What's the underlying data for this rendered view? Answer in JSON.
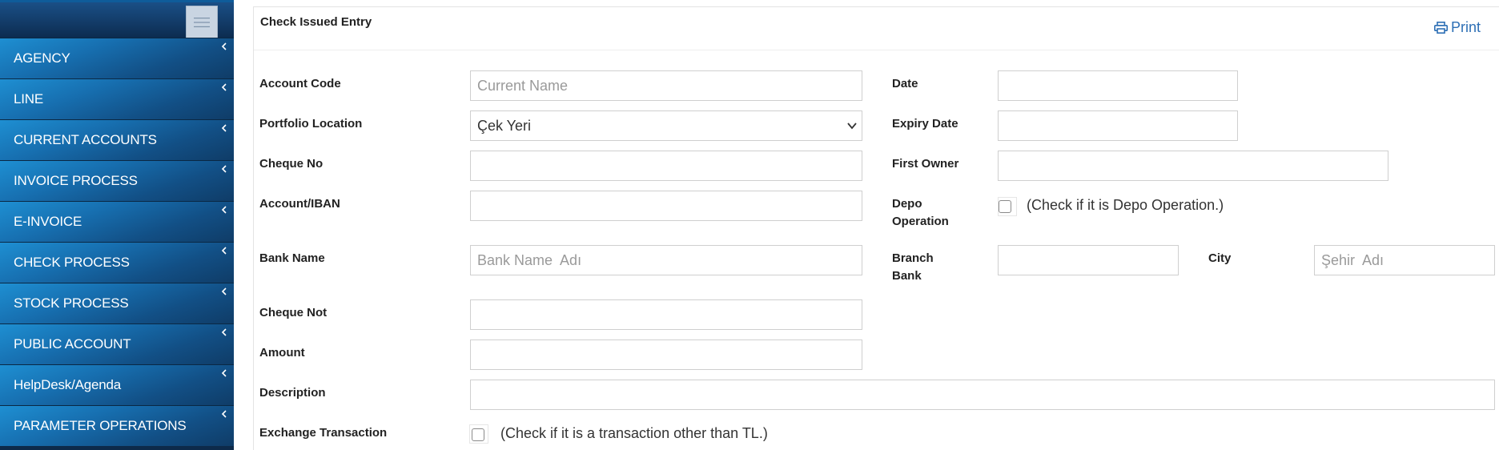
{
  "sidebar": {
    "items": [
      {
        "label": "AGENCY"
      },
      {
        "label": "LINE"
      },
      {
        "label": "CURRENT ACCOUNTS"
      },
      {
        "label": "INVOICE PROCESS"
      },
      {
        "label": "E-INVOICE"
      },
      {
        "label": "CHECK PROCESS"
      },
      {
        "label": "STOCK PROCESS"
      },
      {
        "label": "PUBLIC ACCOUNT"
      },
      {
        "label": "HelpDesk/Agenda"
      },
      {
        "label": "PARAMETER OPERATIONS"
      }
    ]
  },
  "header": {
    "title": "Check Issued Entry",
    "print_label": "Print"
  },
  "form": {
    "account_code_label": "Account Code",
    "account_code_placeholder": "Current Name",
    "date_label": "Date",
    "portfolio_location_label": "Portfolio Location",
    "portfolio_location_value": "Çek Yeri",
    "expiry_date_label": "Expiry Date",
    "cheque_no_label": "Cheque No",
    "first_owner_label": "First Owner",
    "account_iban_label": "Account/IBAN",
    "depo_operation_label_1": "Depo",
    "depo_operation_label_2": "Operation",
    "depo_operation_note": "(Check if it is Depo Operation.)",
    "bank_name_label": "Bank Name",
    "bank_name_placeholder": "Bank Name  Adı",
    "branch_bank_label_1": "Branch",
    "branch_bank_label_2": "Bank",
    "city_label": "City",
    "city_placeholder": "Şehir  Adı",
    "cheque_not_label": "Cheque Not",
    "amount_label": "Amount",
    "description_label": "Description",
    "exchange_transaction_label": "Exchange Transaction",
    "exchange_transaction_note": "(Check if it is a transaction other than TL.)"
  },
  "colors": {
    "accent": "#2d6fb5",
    "sidebar_blue": "#1e8fd2"
  }
}
